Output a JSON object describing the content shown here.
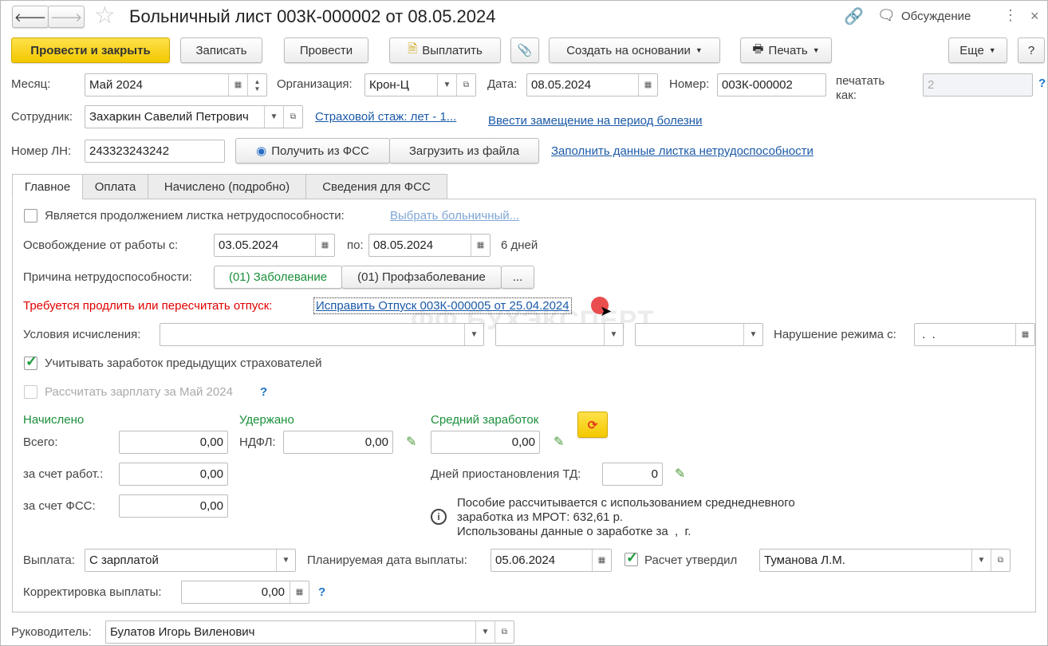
{
  "title": "Больничный лист 003К-000002 от 08.05.2024",
  "header": {
    "discussion": "Обсуждение"
  },
  "toolbar": {
    "post_close": "Провести и закрыть",
    "save": "Записать",
    "post": "Провести",
    "pay": "Выплатить",
    "create_based": "Создать на основании",
    "print": "Печать",
    "more": "Еще",
    "help": "?"
  },
  "fields": {
    "month_label": "Месяц:",
    "month": "Май 2024",
    "org_label": "Организация:",
    "org": "Крон-Ц",
    "date_label": "Дата:",
    "date": "08.05.2024",
    "number_label": "Номер:",
    "number": "003К-000002",
    "print_as_label1": "печатать",
    "print_as_label2": "как:",
    "print_as": "2",
    "employee_label": "Сотрудник:",
    "employee": "Захаркин Савелий Петрович",
    "insurance_link": "Страховой стаж: лет - 1...",
    "replacement_link": "Ввести замещение на период болезни",
    "ln_label": "Номер ЛН:",
    "ln": "243323243242",
    "get_fss": "Получить из ФСС",
    "load_file": "Загрузить из файла",
    "fill_link": "Заполнить данные листка нетрудоспособности"
  },
  "tabs": [
    "Главное",
    "Оплата",
    "Начислено (подробно)",
    "Сведения для ФСС"
  ],
  "main": {
    "continuation_label": "Является продолжением листка нетрудоспособности:",
    "choose_link": "Выбрать больничный...",
    "release_label": "Освобождение от работы с:",
    "release_from": "03.05.2024",
    "to_label": "по:",
    "release_to": "08.05.2024",
    "days": "6 дней",
    "reason_label": "Причина нетрудоспособности:",
    "reason_options": [
      "(01) Заболевание",
      "(01) Профзаболевание",
      "..."
    ],
    "warning": "Требуется продлить или пересчитать отпуск:",
    "fix_link": "Исправить Отпуск 003К-000005 от 25.04.2024",
    "conditions_label": "Условия исчисления:",
    "violation_label": "Нарушение режима с:",
    "violation": " .  .",
    "consider_label": "Учитывать заработок предыдущих страхователей",
    "calc_salary_label": "Рассчитать зарплату за Май 2024",
    "accrued_header": "Начислено",
    "withheld_header": "Удержано",
    "avg_header": "Средний заработок",
    "total_label": "Всего:",
    "total": "0,00",
    "ndfl_label": "НДФЛ:",
    "ndfl": "0,00",
    "avg": "0,00",
    "employer_label": "за счет работ.:",
    "employer": "0,00",
    "suspend_label": "Дней приостановления ТД:",
    "suspend": "0",
    "fss_label": "за счет ФСС:",
    "fss": "0,00",
    "info": [
      "Пособие рассчитывается с использованием среднедневного",
      "заработка из МРОТ: 632,61 р.",
      "Использованы данные о заработке за  ,  г."
    ],
    "payment_label": "Выплата:",
    "payment": "С зарплатой",
    "planned_label": "Планируемая дата выплаты:",
    "planned": "05.06.2024",
    "approved_label": "Расчет утвердил",
    "approved": "Туманова Л.М.",
    "correction_label": "Корректировка выплаты:",
    "correction": "0,00"
  },
  "head_label": "Руководитель:",
  "head": "Булатов Игорь Виленович",
  "watermark": "БУХЭКСПЕРТ",
  "colors": {
    "accent_yellow": "#f3c800",
    "link": "#1b5aa8",
    "warning": "#e00000",
    "green": "#1a8f3a"
  }
}
